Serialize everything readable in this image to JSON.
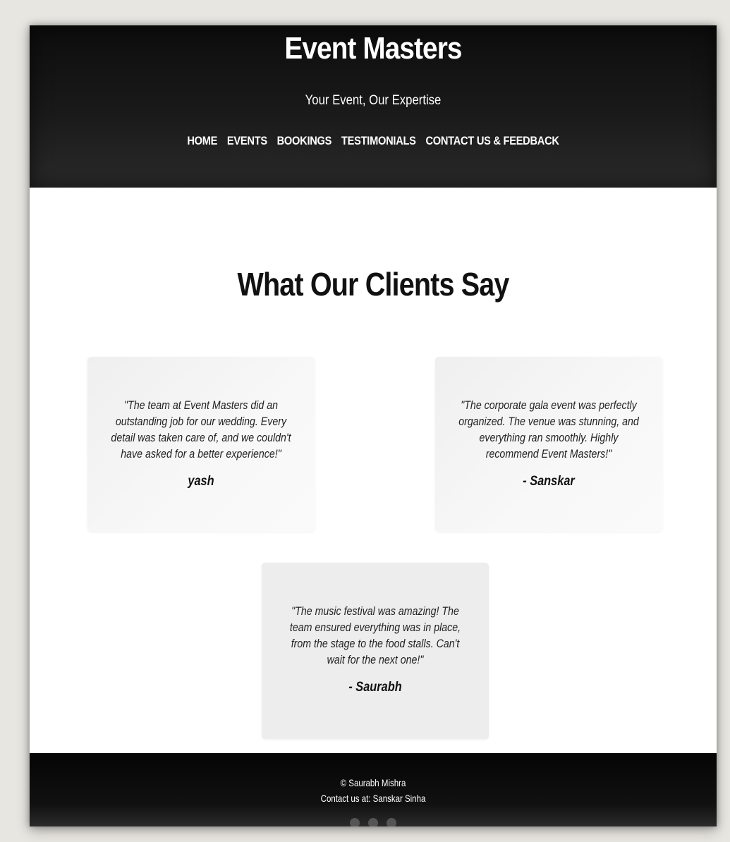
{
  "header": {
    "title": "Event Masters",
    "tagline": "Your Event, Our Expertise",
    "nav": [
      {
        "label": "HOME"
      },
      {
        "label": "EVENTS"
      },
      {
        "label": "BOOKINGS"
      },
      {
        "label": "TESTIMONIALS"
      },
      {
        "label": "CONTACT US & FEEDBACK"
      }
    ]
  },
  "main": {
    "title": "What Our Clients Say",
    "testimonials": [
      {
        "quote": "\"The team at Event Masters did an outstanding job for our wedding. Every detail was taken care of, and we couldn't have asked for a better experience!\"",
        "author": "yash"
      },
      {
        "quote": "\"The corporate gala event was perfectly organized. The venue was stunning, and everything ran smoothly. Highly recommend Event Masters!\"",
        "author": "- Sanskar"
      },
      {
        "quote": "\"The music festival was amazing! The team ensured everything was in place, from the stage to the food stalls. Can't wait for the next one!\"",
        "author": "- Saurabh"
      }
    ]
  },
  "footer": {
    "copyright": "© Saurabh Mishra",
    "contact": "Contact us at: Sanskar Sinha"
  },
  "colors": {
    "header_bg": "#1a1a1a",
    "footer_bg": "#111111",
    "card_bg": "#f4f4f4",
    "page_bg": "#ffffff"
  }
}
